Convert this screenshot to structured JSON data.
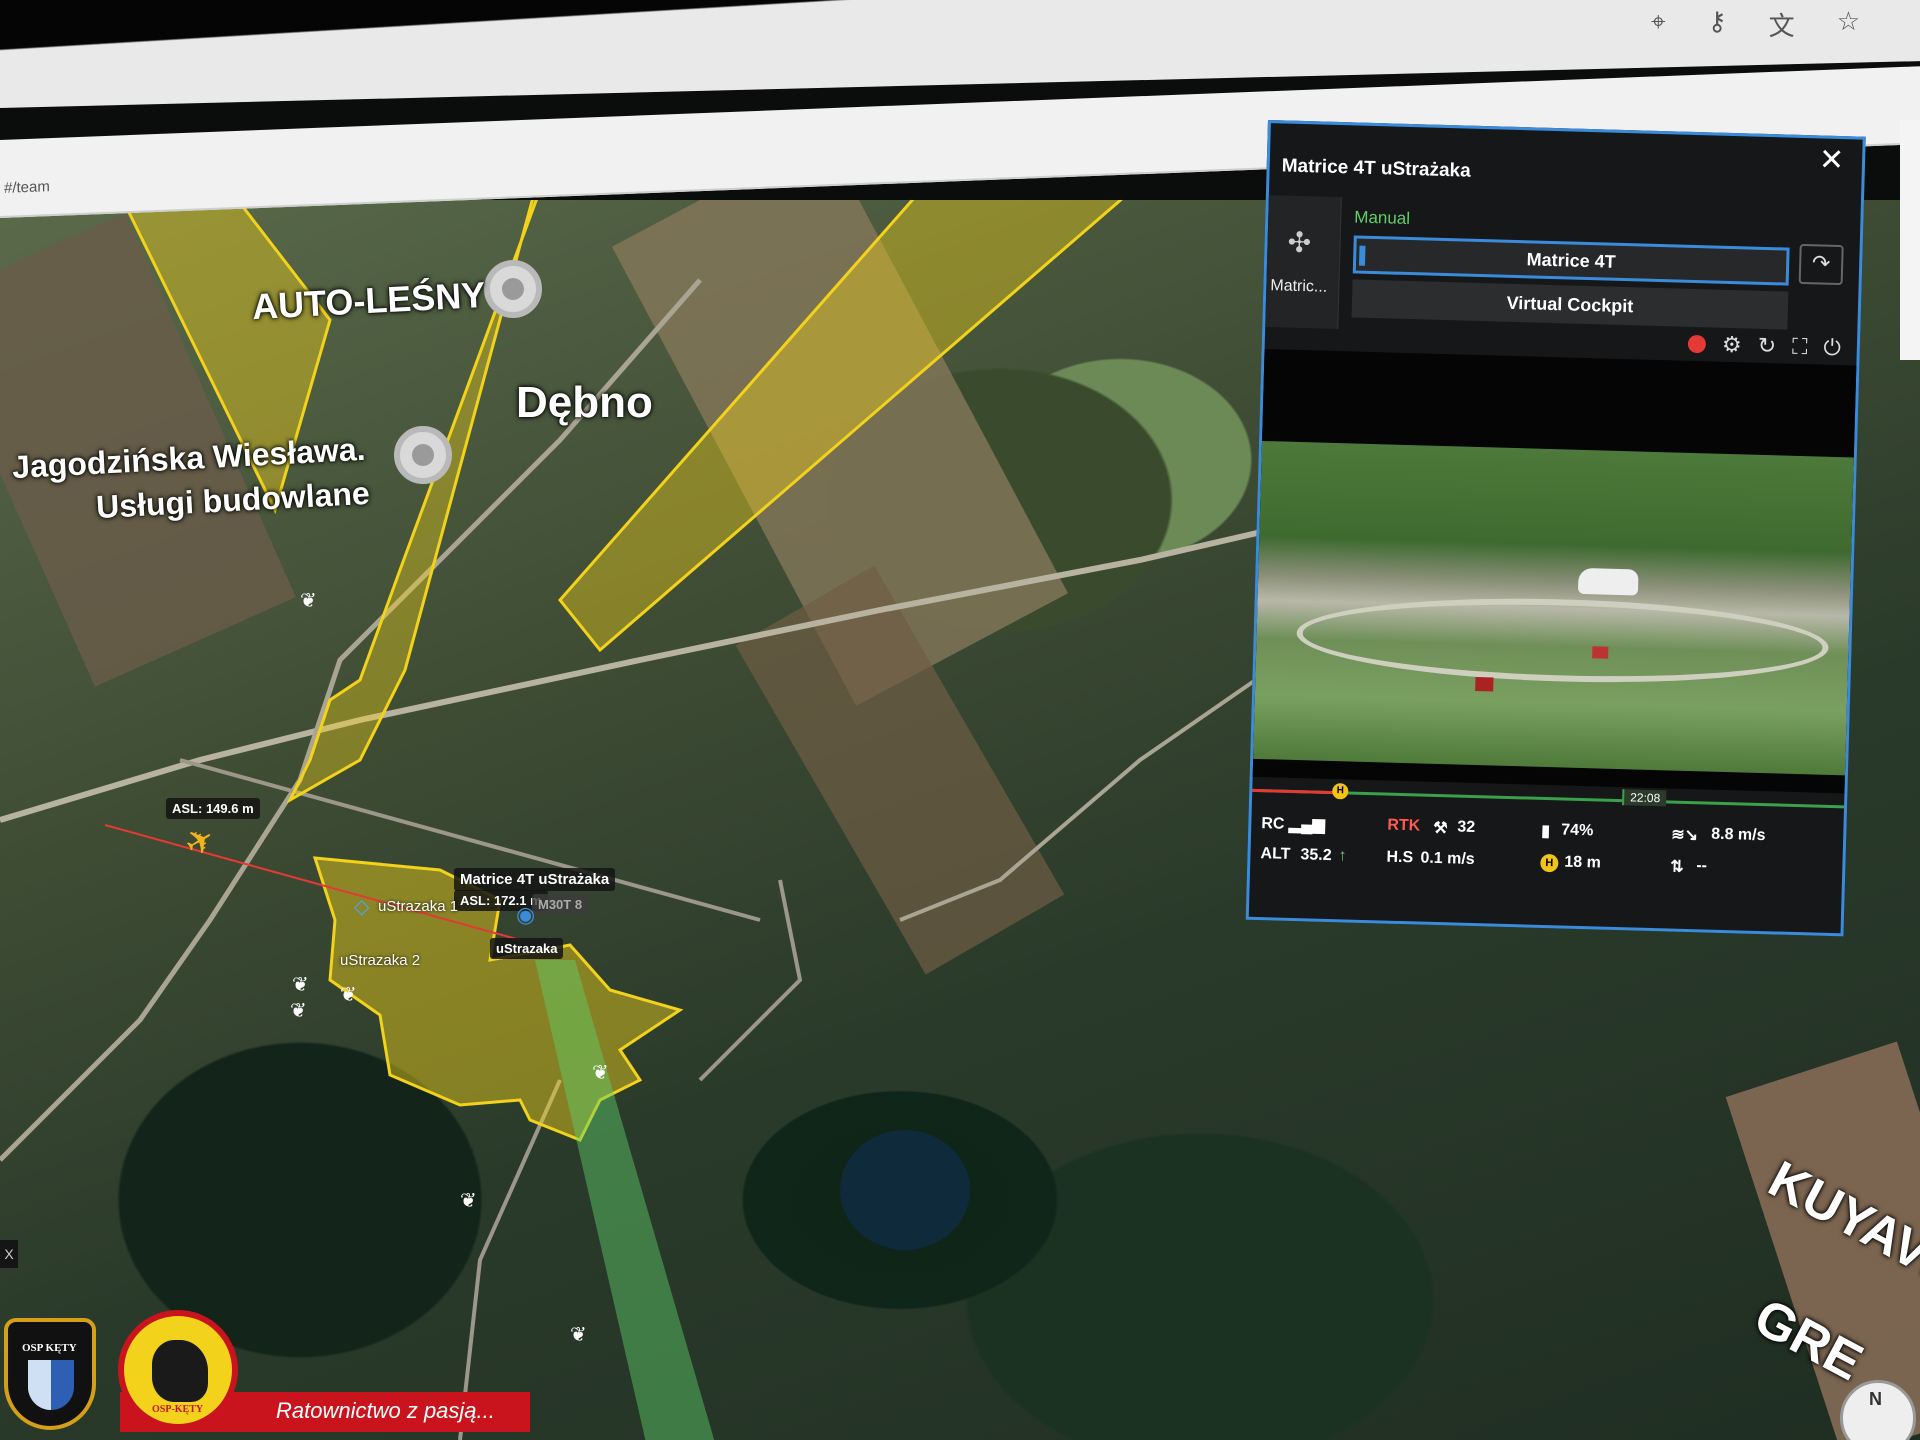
{
  "browser": {
    "address_text": "#/team",
    "toolbar_icons": [
      "location-icon",
      "key-icon",
      "translate-icon",
      "star-icon"
    ]
  },
  "map": {
    "places": [
      {
        "name": "AUTO-LEŚNY"
      },
      {
        "name": "Dębno"
      },
      {
        "name": "Jagodzińska Wiesława."
      },
      {
        "name": "Usługi budowlane"
      },
      {
        "name": "KUYAVI"
      },
      {
        "name": "GRE"
      }
    ],
    "tags": {
      "plane_asl": "ASL: 149.6 m",
      "drone_name": "Matrice 4T uStrażaka",
      "drone_asl": "ASL: 172.1 m",
      "drone_model": "M30T 8",
      "self_label": "uStrazaka",
      "point1": "uStrazaka 1",
      "point2": "uStrazaka 2"
    },
    "overlay_colors": {
      "fov_yellow": "#f2d21a",
      "fov_green": "#5fd06b",
      "flight_line": "#e53935"
    }
  },
  "panel": {
    "title": "Matrice 4T uStrażaka",
    "close_label": "✕",
    "side_label": "Matric...",
    "mode": "Manual",
    "selected_view": "Matrice 4T",
    "other_view": "Virtual Cockpit",
    "share_icon": "share-arrow-icon",
    "timeline_time": "22:08",
    "telemetry": {
      "rc_label": "RC",
      "rtk_label": "RTK",
      "satellites": "32",
      "battery": "74%",
      "wind": "8.8 m/s",
      "alt_label": "ALT",
      "alt_value": "35.2",
      "hs_label": "H.S",
      "hs_value": "0.1 m/s",
      "height": "18 m",
      "vs_value": "--"
    }
  },
  "branding": {
    "tagline": "Ratownictwo z pasją...",
    "logo1_text": "OSP KĘTY",
    "logo2_text": "OSP-KĘTY",
    "side_close": "X",
    "compass_label": "N"
  }
}
